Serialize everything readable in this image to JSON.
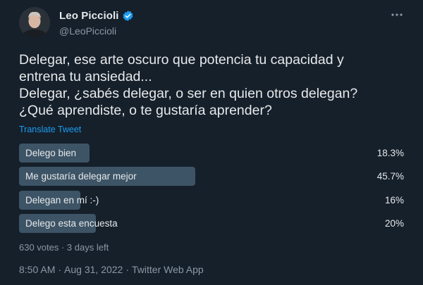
{
  "author": {
    "display_name": "Leo Piccioli",
    "handle": "@LeoPiccioli",
    "verified": true
  },
  "tweet": {
    "text": "Delegar, ese arte oscuro que potencia tu capacidad y\nentrena tu ansiedad...\nDelegar, ¿sabés delegar, o ser en quien otros delegan?\n¿Qué aprendiste, o te gustaría aprender?",
    "translate_label": "Translate Tweet"
  },
  "poll": {
    "options": [
      {
        "label": "Delego bien",
        "percent": 18.3,
        "percent_label": "18.3%"
      },
      {
        "label": "Me gustaría delegar mejor",
        "percent": 45.7,
        "percent_label": "45.7%"
      },
      {
        "label": "Delegan en mí :-)",
        "percent": 16,
        "percent_label": "16%"
      },
      {
        "label": "Delego esta encuesta",
        "percent": 20,
        "percent_label": "20%"
      }
    ],
    "meta": "630 votes · 3 days left"
  },
  "footer": {
    "time": "8:50 AM",
    "separator": "·",
    "date": "Aug 31, 2022",
    "source": "Twitter Web App"
  },
  "colors": {
    "background": "#15202b",
    "text": "#e7e9ea",
    "muted": "#8b98a5",
    "link": "#1d9bf0",
    "poll_bar": "#3d5466",
    "verified": "#1d9bf0"
  },
  "icons": {
    "verified": "verified-badge-icon",
    "more": "more-options-icon"
  }
}
